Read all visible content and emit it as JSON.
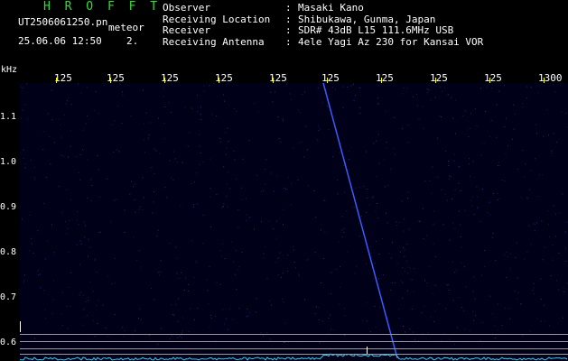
{
  "header": {
    "app_title": "H R O F F T",
    "filename": "UT2506061250.pn",
    "filename_suffix": "meteor",
    "timestamp": "25.06.06 12:50",
    "timestamp_extra": "2.",
    "meta": [
      {
        "label": "Observer",
        "value": "Masaki Kano"
      },
      {
        "label": "Receiving Location",
        "value": "Shibukawa, Gunma, Japan"
      },
      {
        "label": "Receiver",
        "value": "SDR# 43dB L15 111.6MHz USB"
      },
      {
        "label": "Receiving Antenna",
        "value": "4ele Yagi Az 230 for Kansai VOR"
      }
    ],
    "separator": ":"
  },
  "axes": {
    "y_unit": "kHz",
    "y_ticks": [
      "1.1",
      "1.0",
      "0.9",
      "0.8",
      "0.7",
      "0.6"
    ],
    "x_ticks": [
      "125",
      "125",
      "125",
      "125",
      "125",
      "125",
      "125",
      "125",
      "125",
      "1300"
    ]
  },
  "colors": {
    "background": "#000000",
    "plot_bg": "#000018",
    "title_green": "#2fe02f",
    "tick_yellow": "#ffff00",
    "meteor_trace": "#3a5cff",
    "noise_floor": "#30d0ff"
  }
}
